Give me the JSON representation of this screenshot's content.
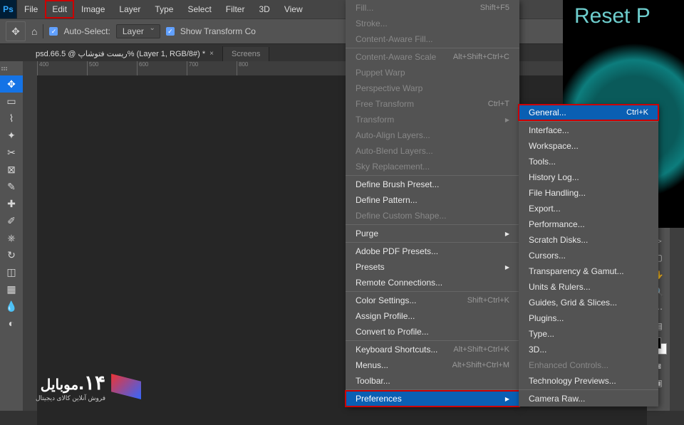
{
  "menubar": [
    "File",
    "Edit",
    "Image",
    "Layer",
    "Type",
    "Select",
    "Filter",
    "3D",
    "View"
  ],
  "options": {
    "auto_select": "Auto-Select:",
    "layer": "Layer",
    "show_transform": "Show Transform Co"
  },
  "doc_tab": "psd.ریست فتوشاپ @ 66.5% (Layer 1, RGB/8#) *",
  "doc_tab2": "Screens",
  "ruler_marks": [
    "400",
    "500",
    "600",
    "700",
    "800"
  ],
  "bgwin": {
    "title": "Reset P"
  },
  "edit_menu": [
    {
      "label": "Fill...",
      "shortcut": "Shift+F5",
      "disabled": true
    },
    {
      "label": "Stroke...",
      "disabled": true
    },
    {
      "label": "Content-Aware Fill...",
      "disabled": true
    },
    {
      "sep": true
    },
    {
      "label": "Content-Aware Scale",
      "shortcut": "Alt+Shift+Ctrl+C",
      "disabled": true
    },
    {
      "label": "Puppet Warp",
      "disabled": true
    },
    {
      "label": "Perspective Warp",
      "disabled": true
    },
    {
      "label": "Free Transform",
      "shortcut": "Ctrl+T",
      "disabled": true
    },
    {
      "label": "Transform",
      "arrow": true,
      "disabled": true
    },
    {
      "label": "Auto-Align Layers...",
      "disabled": true
    },
    {
      "label": "Auto-Blend Layers...",
      "disabled": true
    },
    {
      "label": "Sky Replacement...",
      "disabled": true
    },
    {
      "sep": true
    },
    {
      "label": "Define Brush Preset..."
    },
    {
      "label": "Define Pattern..."
    },
    {
      "label": "Define Custom Shape...",
      "disabled": true
    },
    {
      "sep": true
    },
    {
      "label": "Purge",
      "arrow": true
    },
    {
      "sep": true
    },
    {
      "label": "Adobe PDF Presets..."
    },
    {
      "label": "Presets",
      "arrow": true
    },
    {
      "label": "Remote Connections..."
    },
    {
      "sep": true
    },
    {
      "label": "Color Settings...",
      "shortcut": "Shift+Ctrl+K"
    },
    {
      "label": "Assign Profile..."
    },
    {
      "label": "Convert to Profile..."
    },
    {
      "sep": true
    },
    {
      "label": "Keyboard Shortcuts...",
      "shortcut": "Alt+Shift+Ctrl+K"
    },
    {
      "label": "Menus...",
      "shortcut": "Alt+Shift+Ctrl+M"
    },
    {
      "label": "Toolbar..."
    },
    {
      "sep": true
    },
    {
      "label": "Preferences",
      "arrow": true,
      "highlighted": true,
      "redbox": true
    }
  ],
  "pref_menu": [
    {
      "label": "General...",
      "shortcut": "Ctrl+K",
      "highlighted": true,
      "redbox": true
    },
    {
      "sep": true
    },
    {
      "label": "Interface..."
    },
    {
      "label": "Workspace..."
    },
    {
      "label": "Tools..."
    },
    {
      "label": "History Log..."
    },
    {
      "label": "File Handling..."
    },
    {
      "label": "Export..."
    },
    {
      "label": "Performance..."
    },
    {
      "label": "Scratch Disks..."
    },
    {
      "label": "Cursors..."
    },
    {
      "label": "Transparency & Gamut..."
    },
    {
      "label": "Units & Rulers..."
    },
    {
      "label": "Guides, Grid & Slices..."
    },
    {
      "label": "Plugins..."
    },
    {
      "label": "Type..."
    },
    {
      "label": "3D..."
    },
    {
      "label": "Enhanced Controls...",
      "disabled": true
    },
    {
      "label": "Technology Previews..."
    },
    {
      "sep": true
    },
    {
      "label": "Camera Raw..."
    }
  ],
  "logo": {
    "name": "موبایل",
    "num": "۱۴.",
    "tag": "فروش آنلاین کالای دیجیتال"
  }
}
